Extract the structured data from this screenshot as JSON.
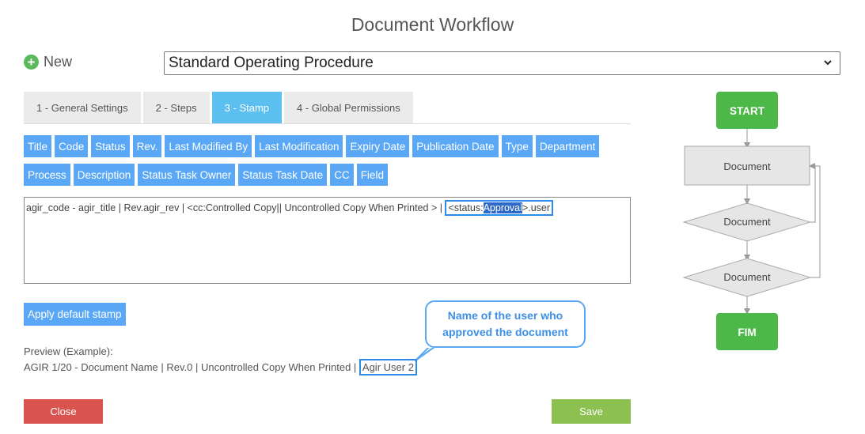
{
  "page": {
    "title": "Document Workflow"
  },
  "new_button": {
    "label": "New"
  },
  "workflow_select": {
    "value": "Standard Operating Procedure"
  },
  "tabs": [
    {
      "label": "1 - General Settings",
      "active": false
    },
    {
      "label": "2 - Steps",
      "active": false
    },
    {
      "label": "3 - Stamp",
      "active": true
    },
    {
      "label": "4 - Global Permissions",
      "active": false
    }
  ],
  "field_buttons_row1": [
    "Title",
    "Code",
    "Status",
    "Rev.",
    "Last Modified By",
    "Last Modification",
    "Expiry Date",
    "Publication Date",
    "Type",
    "Department"
  ],
  "field_buttons_row2": [
    "Process",
    "Description",
    "Status Task Owner",
    "Status Task Date",
    "CC",
    "Field"
  ],
  "stamp": {
    "text_before": "agir_code - agir_title | Rev.agir_rev | <cc:Controlled Copy|| Uncontrolled Copy When Printed > | ",
    "token_prefix": "<status:",
    "token_selected": "Approval",
    "token_suffix": ">.user"
  },
  "apply_default_stamp": {
    "label": "Apply default stamp"
  },
  "callout": {
    "line1": "Name of the user who",
    "line2": "approved the document"
  },
  "preview": {
    "label": "Preview (Example):",
    "text": "AGIR 1/20 - Document Name | Rev.0 | Uncontrolled Copy When Printed | ",
    "user": "Agir User 2"
  },
  "actions": {
    "close_label": "Close",
    "save_label": "Save"
  },
  "flowchart": {
    "start": "START",
    "node1": "Document",
    "node2": "Document",
    "node3": "Document",
    "end": "FIM"
  },
  "colors": {
    "tab_active": "#5bc0f0",
    "field_button": "#5aa8f5",
    "highlight": "#2d8be8",
    "close": "#d9534f",
    "save": "#8cc152",
    "flow_terminal": "#4cb848",
    "flow_node": "#e6e6e6"
  }
}
